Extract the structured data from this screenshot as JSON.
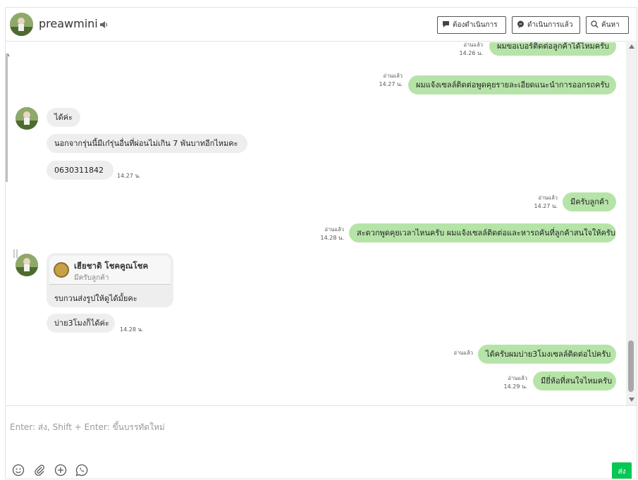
{
  "header": {
    "contact_name": "preawmini",
    "btn_todo": "ต้องดำเนินการ",
    "btn_done": "ดำเนินการแล้ว",
    "btn_search": "ค้นหา"
  },
  "messages": [
    {
      "dir": "out",
      "text": "ผมขอเบอร์ติดต่อลูกค้าได้ไหมครับ",
      "read": "อ่านแล้ว",
      "time": "14.26 น."
    },
    {
      "dir": "out",
      "text": "ผมแจ้งเซลล์ติดต่อพูดคุยรายละเอียดแนะนำการออกรถครับ",
      "read": "อ่านแล้ว",
      "time": "14.27 น."
    },
    {
      "dir": "in",
      "text": "ได้ค่ะ"
    },
    {
      "dir": "in",
      "text": "นอกจากรุ่นนี้มีเก๋รุ่นอื่นที่ผ่อนไม่เกิน 7 พันบาทอีกไหมคะ"
    },
    {
      "dir": "in",
      "text": "0630311842",
      "time": "14.27 น."
    },
    {
      "dir": "out",
      "text": "มีครับลูกค้า",
      "read": "อ่านแล้ว",
      "time": "14.27 น."
    },
    {
      "dir": "out",
      "text": "สะดวกพูดคุยเวลาไหนครับ ผมแจ้งเซลล์ติดต่อและหารถคันที่ลูกค้าสนใจให้ครับ",
      "read": "อ่านแล้ว",
      "time": "14.28 น."
    },
    {
      "dir": "in",
      "text": "บ่าย3โมงก็ได้ค่ะ",
      "time": "14.28 น."
    },
    {
      "dir": "out",
      "text": "ได้ครับผมบ่าย3โมงเซลล์ติดต่อไปครับ",
      "read": "อ่านแล้ว"
    },
    {
      "dir": "out",
      "text": "มียี่ห้อที่สนใจไหมครับ",
      "read": "อ่านแล้ว",
      "time": "14.29 น."
    }
  ],
  "reply_card": {
    "quoted_name": "เฮียชาติ โชคคูณโชค",
    "quoted_text": "มีครับลูกค้า",
    "reply_text": "รบกวนส่งรูปให้ดูได้มั้ยคะ"
  },
  "composer": {
    "placeholder": "Enter: ส่ง, Shift + Enter: ขึ้นบรรทัดใหม่",
    "send_label": "ส่ง"
  },
  "icons": [
    "speaker-icon",
    "comment-icon",
    "search-icon",
    "emoji-icon",
    "attach-icon",
    "add-icon",
    "whatsapp-icon"
  ],
  "colors": {
    "outgoing_bubble": "#b6e4a8",
    "incoming_bubble": "#eeeeef",
    "send_button": "#06c755"
  }
}
